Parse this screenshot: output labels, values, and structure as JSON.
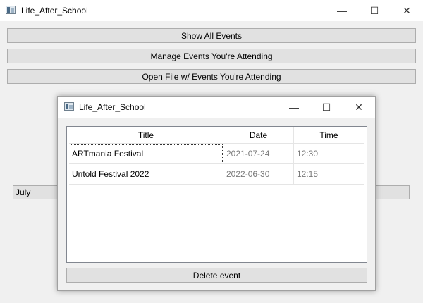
{
  "main_window": {
    "title": "Life_After_School",
    "buttons": {
      "show_all": "Show All Events",
      "manage": "Manage Events You're Attending",
      "open_file": "Open File w/ Events You're Attending"
    },
    "month_field": "July"
  },
  "dialog": {
    "title": "Life_After_School",
    "columns": [
      "Title",
      "Date",
      "Time"
    ],
    "rows": [
      {
        "title": "ARTmania Festival",
        "date": "2021-07-24",
        "time": "12:30"
      },
      {
        "title": "Untold Festival 2022",
        "date": "2022-06-30",
        "time": "12:15"
      }
    ],
    "delete_label": "Delete event"
  },
  "icons": {
    "minimize": "minimize-icon",
    "maximize": "maximize-icon",
    "close": "close-icon",
    "app": "app-window-icon"
  }
}
